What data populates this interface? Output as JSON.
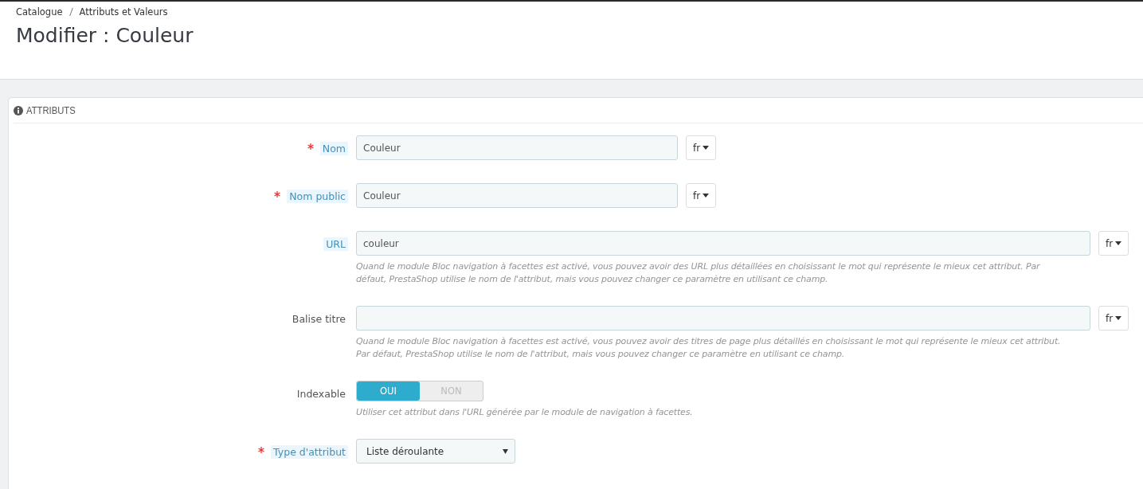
{
  "breadcrumb": [
    "Catalogue",
    "Attributs et Valeurs"
  ],
  "page_title": "Modifier : Couleur",
  "panel": {
    "heading": "ATTRIBUTS",
    "fields": [
      {
        "kind": "text",
        "label": "Nom",
        "required": true,
        "hint": true,
        "value": "Couleur",
        "wide": false,
        "lang": "fr"
      },
      {
        "kind": "text",
        "label": "Nom public",
        "required": true,
        "hint": true,
        "value": "Couleur",
        "wide": false,
        "lang": "fr"
      },
      {
        "kind": "text",
        "label": "URL",
        "required": false,
        "hint": true,
        "value": "couleur",
        "wide": true,
        "lang": "fr",
        "help": [
          "Quand le module Bloc navigation à facettes est activé, vous pouvez avoir des URL plus détaillées en choisissant le mot qui représente le mieux cet attribut. Par",
          "défaut, PrestaShop utilise le nom de l'attribut, mais vous pouvez changer ce paramètre en utilisant ce champ."
        ]
      },
      {
        "kind": "text",
        "label": "Balise titre",
        "required": false,
        "hint": false,
        "wide": true,
        "lang": "fr",
        "help": [
          "Quand le module Bloc navigation à facettes est activé, vous pouvez avoir des titres de page plus détaillés en choisissant le mot qui représente le mieux cet attribut.",
          "Par défaut, PrestaShop utilise le nom de l'attribut, mais vous pouvez changer ce paramètre en utilisant ce champ."
        ]
      },
      {
        "kind": "toggle",
        "label": "Indexable",
        "required": false,
        "hint": false,
        "options": [
          {
            "label": "OUI",
            "selected": true
          },
          {
            "label": "NON",
            "selected": false
          }
        ],
        "help": [
          "Utiliser cet attribut dans l'URL générée par le module de navigation à facettes."
        ]
      },
      {
        "kind": "select",
        "label": "Type d'attribut",
        "required": true,
        "hint": true,
        "value": "Liste déroulante"
      }
    ]
  }
}
